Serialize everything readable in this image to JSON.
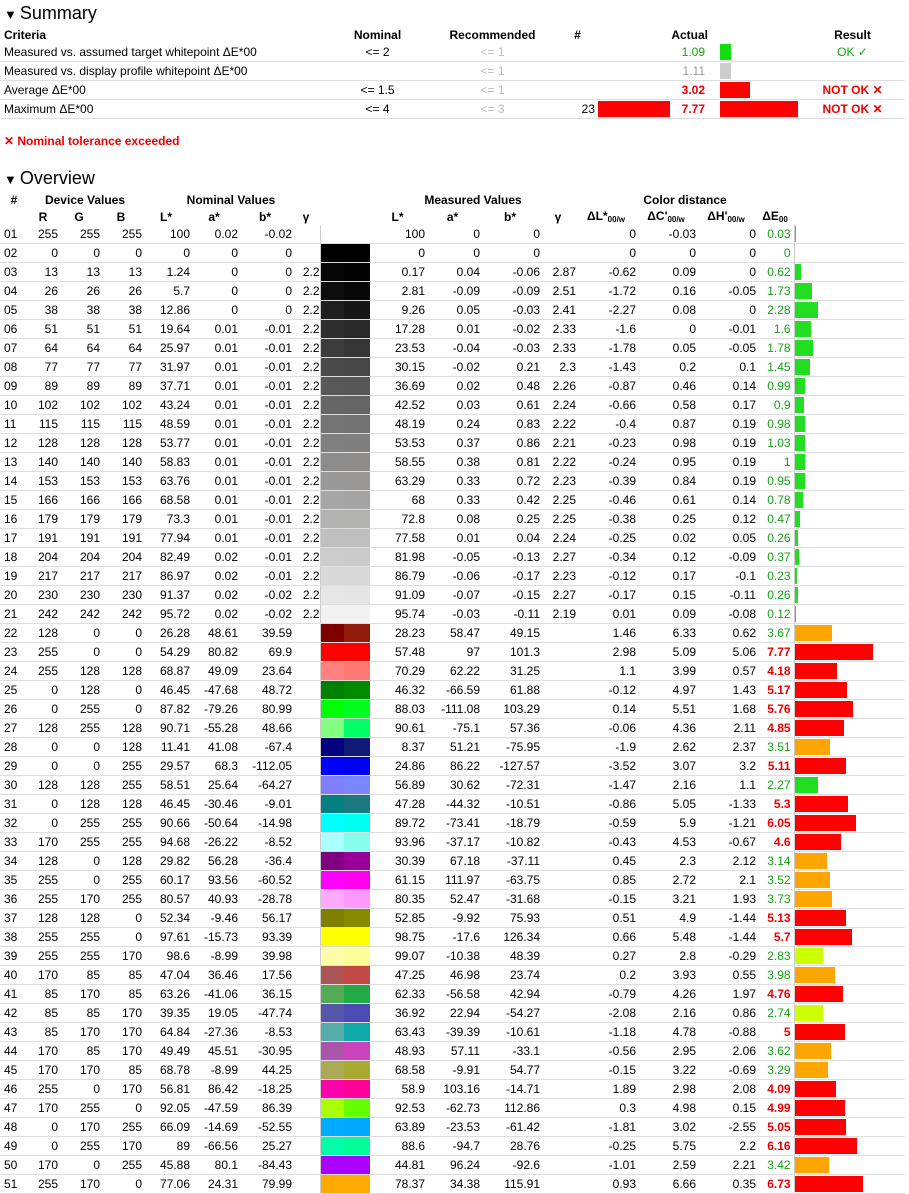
{
  "summary": {
    "title": "Summary",
    "headers": {
      "criteria": "Criteria",
      "nominal": "Nominal",
      "recommended": "Recommended",
      "count": "#",
      "actual": "Actual",
      "result": "Result"
    },
    "rows": [
      {
        "criteria": "Measured vs. assumed target whitepoint ΔE*00",
        "nominal": "<= 2",
        "recommended": "<= 1",
        "count": "",
        "actual": "1.09",
        "actual_state": "ok",
        "count_bar": 0,
        "actual_bar": 0.14,
        "bar_color": "#11dd11",
        "result": "OK ✓",
        "result_state": "ok"
      },
      {
        "criteria": "Measured vs. display profile whitepoint ΔE*00",
        "nominal": "",
        "recommended": "<= 1",
        "count": "",
        "actual": "1.11",
        "actual_state": "gray",
        "count_bar": 0,
        "actual_bar": 0.14,
        "bar_color": "#cccccc",
        "result": "",
        "result_state": ""
      },
      {
        "criteria": "Average ΔE*00",
        "nominal": "<= 1.5",
        "recommended": "<= 1",
        "count": "",
        "actual": "3.02",
        "actual_state": "bad",
        "count_bar": 0,
        "actual_bar": 0.39,
        "bar_color": "#ff0000",
        "result": "NOT OK ✕",
        "result_state": "bad"
      },
      {
        "criteria": "Maximum ΔE*00",
        "nominal": "<= 4",
        "recommended": "<= 3",
        "count": "23",
        "actual": "7.77",
        "actual_state": "bad",
        "count_bar": 1,
        "actual_bar": 1,
        "bar_color": "#ff0000",
        "result": "NOT OK ✕",
        "result_state": "bad"
      }
    ],
    "tolerance_msg": "✕ Nominal tolerance exceeded"
  },
  "overview": {
    "title": "Overview",
    "group_headers": {
      "num": "#",
      "device": "Device Values",
      "nominal": "Nominal Values",
      "measured": "Measured Values",
      "distance": "Color distance"
    },
    "sub_headers": {
      "r": "R",
      "g": "G",
      "b": "B",
      "L": "L*",
      "a": "a*",
      "bstar": "b*",
      "gamma": "γ",
      "dL": "ΔL*",
      "dC": "ΔC'",
      "dH": "ΔH'",
      "dE": "ΔE",
      "sub_w": "00/w",
      "sub_00": "00"
    },
    "max_de": 7.77,
    "rows": [
      [
        "01",
        "255",
        "255",
        "255",
        "100",
        "0.02",
        "-0.02",
        "",
        "100",
        "0",
        "0",
        "",
        "0",
        "-0.03",
        "0",
        "0.03",
        "#ffffff",
        "#ffffff"
      ],
      [
        "02",
        "0",
        "0",
        "0",
        "0",
        "0",
        "0",
        "",
        "0",
        "0",
        "0",
        "",
        "0",
        "0",
        "0",
        "0",
        "#000000",
        "#000000"
      ],
      [
        "03",
        "13",
        "13",
        "13",
        "1.24",
        "0",
        "0",
        "2.2",
        "0.17",
        "0.04",
        "-0.06",
        "2.87",
        "-0.62",
        "0.09",
        "0",
        "0.62",
        "#050505",
        "#020202"
      ],
      [
        "04",
        "26",
        "26",
        "26",
        "5.7",
        "0",
        "0",
        "2.2",
        "2.81",
        "-0.09",
        "-0.09",
        "2.51",
        "-1.72",
        "0.16",
        "-0.05",
        "1.73",
        "#0d0d0d",
        "#080808"
      ],
      [
        "05",
        "38",
        "38",
        "38",
        "12.86",
        "0",
        "0",
        "2.2",
        "9.26",
        "0.05",
        "-0.03",
        "2.41",
        "-2.27",
        "0.08",
        "0",
        "2.28",
        "#1e1e1e",
        "#161616"
      ],
      [
        "06",
        "51",
        "51",
        "51",
        "19.64",
        "0.01",
        "-0.01",
        "2.2",
        "17.28",
        "0.01",
        "-0.02",
        "2.33",
        "-1.6",
        "0",
        "-0.01",
        "1.6",
        "#2e2e2e",
        "#282828"
      ],
      [
        "07",
        "64",
        "64",
        "64",
        "25.97",
        "0.01",
        "-0.01",
        "2.2",
        "23.53",
        "-0.04",
        "-0.03",
        "2.33",
        "-1.78",
        "0.05",
        "-0.05",
        "1.78",
        "#3c3c3c",
        "#363636"
      ],
      [
        "08",
        "77",
        "77",
        "77",
        "31.97",
        "0.01",
        "-0.01",
        "2.2",
        "30.15",
        "-0.02",
        "0.21",
        "2.3",
        "-1.43",
        "0.2",
        "0.1",
        "1.45",
        "#4a4a4a",
        "#464646"
      ],
      [
        "09",
        "89",
        "89",
        "89",
        "37.71",
        "0.01",
        "-0.01",
        "2.2",
        "36.69",
        "0.02",
        "0.48",
        "2.26",
        "-0.87",
        "0.46",
        "0.14",
        "0.99",
        "#585858",
        "#565656"
      ],
      [
        "10",
        "102",
        "102",
        "102",
        "43.24",
        "0.01",
        "-0.01",
        "2.2",
        "42.52",
        "0.03",
        "0.61",
        "2.24",
        "-0.66",
        "0.58",
        "0.17",
        "0.9",
        "#666666",
        "#646464"
      ],
      [
        "11",
        "115",
        "115",
        "115",
        "48.59",
        "0.01",
        "-0.01",
        "2.2",
        "48.19",
        "0.24",
        "0.83",
        "2.22",
        "-0.4",
        "0.87",
        "0.19",
        "0.98",
        "#737373",
        "#727272"
      ],
      [
        "12",
        "128",
        "128",
        "128",
        "53.77",
        "0.01",
        "-0.01",
        "2.2",
        "53.53",
        "0.37",
        "0.86",
        "2.21",
        "-0.23",
        "0.98",
        "0.19",
        "1.03",
        "#808080",
        "#807f7f"
      ],
      [
        "13",
        "140",
        "140",
        "140",
        "58.83",
        "0.01",
        "-0.01",
        "2.2",
        "58.55",
        "0.38",
        "0.81",
        "2.22",
        "-0.24",
        "0.95",
        "0.19",
        "1",
        "#8c8c8c",
        "#8d8c8b"
      ],
      [
        "14",
        "153",
        "153",
        "153",
        "63.76",
        "0.01",
        "-0.01",
        "2.2",
        "63.29",
        "0.33",
        "0.72",
        "2.23",
        "-0.39",
        "0.84",
        "0.19",
        "0.95",
        "#999999",
        "#999897"
      ],
      [
        "15",
        "166",
        "166",
        "166",
        "68.58",
        "0.01",
        "-0.01",
        "2.2",
        "68",
        "0.33",
        "0.42",
        "2.25",
        "-0.46",
        "0.61",
        "0.14",
        "0.78",
        "#a6a6a6",
        "#a5a4a4"
      ],
      [
        "16",
        "179",
        "179",
        "179",
        "73.3",
        "0.01",
        "-0.01",
        "2.2",
        "72.8",
        "0.08",
        "0.25",
        "2.25",
        "-0.38",
        "0.25",
        "0.12",
        "0.47",
        "#b3b3b3",
        "#b2b2b1"
      ],
      [
        "17",
        "191",
        "191",
        "191",
        "77.94",
        "0.01",
        "-0.01",
        "2.2",
        "77.58",
        "0.01",
        "0.04",
        "2.24",
        "-0.25",
        "0.02",
        "0.05",
        "0.26",
        "#bfbfbf",
        "#bebebe"
      ],
      [
        "18",
        "204",
        "204",
        "204",
        "82.49",
        "0.02",
        "-0.01",
        "2.2",
        "81.98",
        "-0.05",
        "-0.13",
        "2.27",
        "-0.34",
        "0.12",
        "-0.09",
        "0.37",
        "#cccccc",
        "#cbcbcc"
      ],
      [
        "19",
        "217",
        "217",
        "217",
        "86.97",
        "0.02",
        "-0.01",
        "2.2",
        "86.79",
        "-0.06",
        "-0.17",
        "2.23",
        "-0.12",
        "0.17",
        "-0.1",
        "0.23",
        "#d9d9d9",
        "#d8d8d9"
      ],
      [
        "20",
        "230",
        "230",
        "230",
        "91.37",
        "0.02",
        "-0.02",
        "2.2",
        "91.09",
        "-0.07",
        "-0.15",
        "2.27",
        "-0.17",
        "0.15",
        "-0.11",
        "0.26",
        "#e6e6e6",
        "#e5e5e6"
      ],
      [
        "21",
        "242",
        "242",
        "242",
        "95.72",
        "0.02",
        "-0.02",
        "2.2",
        "95.74",
        "-0.03",
        "-0.11",
        "2.19",
        "0.01",
        "0.09",
        "-0.08",
        "0.12",
        "#f2f2f2",
        "#f2f2f3"
      ],
      [
        "22",
        "128",
        "0",
        "0",
        "26.28",
        "48.61",
        "39.59",
        "",
        "28.23",
        "58.47",
        "49.15",
        "",
        "1.46",
        "6.33",
        "0.62",
        "3.67",
        "#800000",
        "#921a0a"
      ],
      [
        "23",
        "255",
        "0",
        "0",
        "54.29",
        "80.82",
        "69.9",
        "",
        "57.48",
        "97",
        "101.3",
        "",
        "2.98",
        "5.09",
        "5.06",
        "7.77",
        "#ff0000",
        "#ff0000"
      ],
      [
        "24",
        "255",
        "128",
        "128",
        "68.87",
        "49.09",
        "23.64",
        "",
        "70.29",
        "62.22",
        "31.25",
        "",
        "1.1",
        "3.99",
        "0.57",
        "4.18",
        "#ff8080",
        "#ff7a75"
      ],
      [
        "25",
        "0",
        "128",
        "0",
        "46.45",
        "-47.68",
        "48.72",
        "",
        "46.32",
        "-66.59",
        "61.88",
        "",
        "-0.12",
        "4.97",
        "1.43",
        "5.17",
        "#008000",
        "#008a00"
      ],
      [
        "26",
        "0",
        "255",
        "0",
        "87.82",
        "-79.26",
        "80.99",
        "",
        "88.03",
        "-111.08",
        "103.29",
        "",
        "0.14",
        "5.51",
        "1.68",
        "5.76",
        "#00ff00",
        "#00ff1e"
      ],
      [
        "27",
        "128",
        "255",
        "128",
        "90.71",
        "-55.28",
        "48.66",
        "",
        "90.61",
        "-75.1",
        "57.36",
        "",
        "-0.06",
        "4.36",
        "2.11",
        "4.85",
        "#80ff80",
        "#00ff66"
      ],
      [
        "28",
        "0",
        "0",
        "128",
        "11.41",
        "41.08",
        "-67.4",
        "",
        "8.37",
        "51.21",
        "-75.95",
        "",
        "-1.9",
        "2.62",
        "2.37",
        "3.51",
        "#000080",
        "#111a77"
      ],
      [
        "29",
        "0",
        "0",
        "255",
        "29.57",
        "68.3",
        "-112.05",
        "",
        "24.86",
        "86.22",
        "-127.57",
        "",
        "-3.52",
        "3.07",
        "3.2",
        "5.11",
        "#0000ff",
        "#0000ee"
      ],
      [
        "30",
        "128",
        "128",
        "255",
        "58.51",
        "25.64",
        "-64.27",
        "",
        "56.89",
        "30.62",
        "-72.31",
        "",
        "-1.47",
        "2.16",
        "1.1",
        "2.27",
        "#8080ff",
        "#7a88ff"
      ],
      [
        "31",
        "0",
        "128",
        "128",
        "46.45",
        "-30.46",
        "-9.01",
        "",
        "47.28",
        "-44.32",
        "-10.51",
        "",
        "-0.86",
        "5.05",
        "-1.33",
        "5.3",
        "#008080",
        "#1a7a80"
      ],
      [
        "32",
        "0",
        "255",
        "255",
        "90.66",
        "-50.64",
        "-14.98",
        "",
        "89.72",
        "-73.41",
        "-18.79",
        "",
        "-0.59",
        "5.9",
        "-1.21",
        "6.05",
        "#00ffff",
        "#00fff0"
      ],
      [
        "33",
        "170",
        "255",
        "255",
        "94.68",
        "-26.22",
        "-8.52",
        "",
        "93.96",
        "-37.17",
        "-10.82",
        "",
        "-0.43",
        "4.53",
        "-0.67",
        "4.6",
        "#aaffff",
        "#88ffee"
      ],
      [
        "34",
        "128",
        "0",
        "128",
        "29.82",
        "56.28",
        "-36.4",
        "",
        "30.39",
        "67.18",
        "-37.11",
        "",
        "0.45",
        "2.3",
        "2.12",
        "3.14",
        "#800080",
        "#990099"
      ],
      [
        "35",
        "255",
        "0",
        "255",
        "60.17",
        "93.56",
        "-60.52",
        "",
        "61.15",
        "111.97",
        "-63.75",
        "",
        "0.85",
        "2.72",
        "2.1",
        "3.52",
        "#ff00ff",
        "#ff00ee"
      ],
      [
        "36",
        "255",
        "170",
        "255",
        "80.57",
        "40.93",
        "-28.78",
        "",
        "80.35",
        "52.47",
        "-31.68",
        "",
        "-0.15",
        "3.21",
        "1.93",
        "3.73",
        "#ffaaff",
        "#ff99ff"
      ],
      [
        "37",
        "128",
        "128",
        "0",
        "52.34",
        "-9.46",
        "56.17",
        "",
        "52.85",
        "-9.92",
        "75.93",
        "",
        "0.51",
        "4.9",
        "-1.44",
        "5.13",
        "#808000",
        "#888a00"
      ],
      [
        "38",
        "255",
        "255",
        "0",
        "97.61",
        "-15.73",
        "93.39",
        "",
        "98.75",
        "-17.6",
        "126.34",
        "",
        "0.66",
        "5.48",
        "-1.44",
        "5.7",
        "#ffff00",
        "#ffff00"
      ],
      [
        "39",
        "255",
        "255",
        "170",
        "98.6",
        "-8.99",
        "39.98",
        "",
        "99.07",
        "-10.38",
        "48.39",
        "",
        "0.27",
        "2.8",
        "-0.29",
        "2.83",
        "#ffffaa",
        "#ffff99"
      ],
      [
        "40",
        "170",
        "85",
        "85",
        "47.04",
        "36.46",
        "17.56",
        "",
        "47.25",
        "46.98",
        "23.74",
        "",
        "0.2",
        "3.93",
        "0.55",
        "3.98",
        "#aa5555",
        "#c24a44"
      ],
      [
        "41",
        "85",
        "170",
        "85",
        "63.26",
        "-41.06",
        "36.15",
        "",
        "62.33",
        "-56.58",
        "42.94",
        "",
        "-0.79",
        "4.26",
        "1.97",
        "4.76",
        "#55aa55",
        "#22aa44"
      ],
      [
        "42",
        "85",
        "85",
        "170",
        "39.35",
        "19.05",
        "-47.74",
        "",
        "36.92",
        "22.94",
        "-54.27",
        "",
        "-2.08",
        "2.16",
        "0.86",
        "2.74",
        "#5555aa",
        "#4c4cb3"
      ],
      [
        "43",
        "85",
        "170",
        "170",
        "64.84",
        "-27.36",
        "-8.53",
        "",
        "63.43",
        "-39.39",
        "-10.61",
        "",
        "-1.18",
        "4.78",
        "-0.88",
        "5",
        "#55aaaa",
        "#11aaaa"
      ],
      [
        "44",
        "170",
        "85",
        "170",
        "49.49",
        "45.51",
        "-30.95",
        "",
        "48.93",
        "57.11",
        "-33.1",
        "",
        "-0.56",
        "2.95",
        "2.06",
        "3.62",
        "#aa55aa",
        "#cc44bb"
      ],
      [
        "45",
        "170",
        "170",
        "85",
        "68.78",
        "-8.99",
        "44.25",
        "",
        "68.58",
        "-9.91",
        "54.77",
        "",
        "-0.15",
        "3.22",
        "-0.69",
        "3.29",
        "#aaaa55",
        "#aaaa33"
      ],
      [
        "46",
        "255",
        "0",
        "170",
        "56.81",
        "86.42",
        "-18.25",
        "",
        "58.9",
        "103.16",
        "-14.71",
        "",
        "1.89",
        "2.98",
        "2.08",
        "4.09",
        "#ff00aa",
        "#ff0099"
      ],
      [
        "47",
        "170",
        "255",
        "0",
        "92.05",
        "-47.59",
        "86.39",
        "",
        "92.53",
        "-62.73",
        "112.86",
        "",
        "0.3",
        "4.98",
        "0.15",
        "4.99",
        "#aaff00",
        "#66ff00"
      ],
      [
        "48",
        "0",
        "170",
        "255",
        "66.09",
        "-14.69",
        "-52.55",
        "",
        "63.89",
        "-23.53",
        "-61.42",
        "",
        "-1.81",
        "3.02",
        "-2.55",
        "5.05",
        "#00aaff",
        "#00a8ff"
      ],
      [
        "49",
        "0",
        "255",
        "170",
        "89",
        "-66.56",
        "25.27",
        "",
        "88.6",
        "-94.7",
        "28.76",
        "",
        "-0.25",
        "5.75",
        "2.2",
        "6.16",
        "#00ffaa",
        "#00ff99"
      ],
      [
        "50",
        "170",
        "0",
        "255",
        "45.88",
        "80.1",
        "-84.43",
        "",
        "44.81",
        "96.24",
        "-92.6",
        "",
        "-1.01",
        "2.59",
        "2.21",
        "3.42",
        "#aa00ff",
        "#aa00ff"
      ],
      [
        "51",
        "255",
        "170",
        "0",
        "77.06",
        "24.31",
        "79.99",
        "",
        "78.37",
        "34.38",
        "115.91",
        "",
        "0.93",
        "6.66",
        "0.35",
        "6.73",
        "#ffaa00",
        "#ffaa00"
      ]
    ]
  }
}
